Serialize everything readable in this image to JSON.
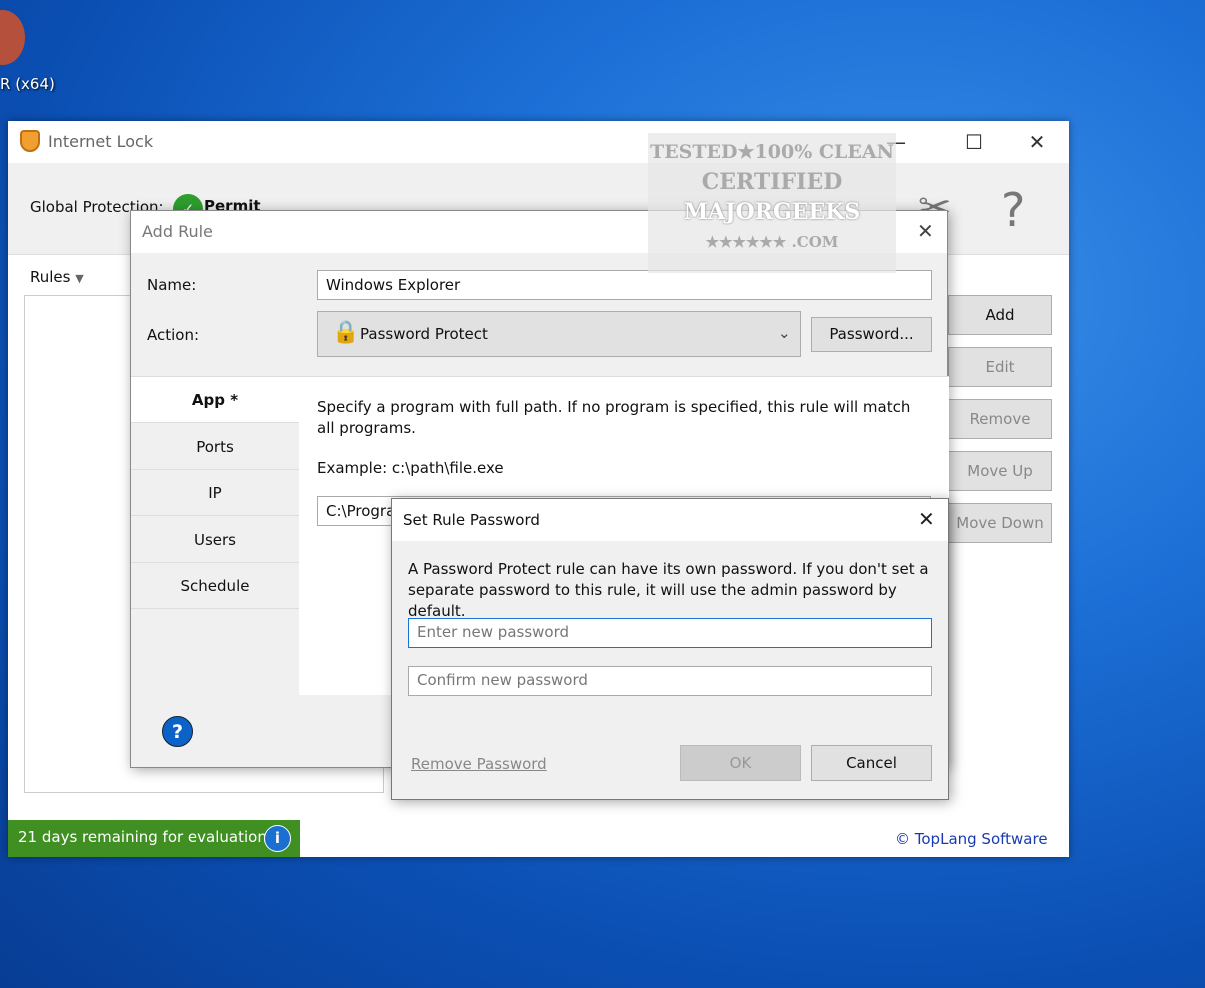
{
  "desktop": {
    "icon_label": "R (x64)"
  },
  "main": {
    "title": "Internet Lock",
    "global_protection_label": "Global Protection:",
    "protection_value": "Permit",
    "rules_label": "Rules",
    "buttons": [
      "Add",
      "Edit",
      "Remove",
      "Move Up",
      "Move Down"
    ],
    "status": "21 days remaining for evaluation",
    "copyright": "© TopLang Software"
  },
  "watermark": {
    "line1": "TESTED★100% CLEAN",
    "line2": "CERTIFIED",
    "line3": "MAJORGEEKS",
    "line4": "★★★★★★ .COM"
  },
  "add_rule": {
    "title": "Add Rule",
    "name_label": "Name:",
    "name_value": "Windows Explorer",
    "action_label": "Action:",
    "action_value": "Password Protect",
    "password_button": "Password...",
    "tabs": [
      "App *",
      "Ports",
      "IP",
      "Users",
      "Schedule"
    ],
    "description": "Specify a program with full path. If no program is specified, this rule will match all programs.",
    "example": "Example: c:\\path\\file.exe",
    "path_value": "C:\\Progra"
  },
  "set_password": {
    "title": "Set Rule Password",
    "message": "A Password Protect rule can have its own password. If you don't set a separate password to this rule, it will use the admin password by default.",
    "new_placeholder": "Enter new password",
    "confirm_placeholder": "Confirm new password",
    "remove_link": "Remove Password",
    "ok": "OK",
    "cancel": "Cancel"
  }
}
